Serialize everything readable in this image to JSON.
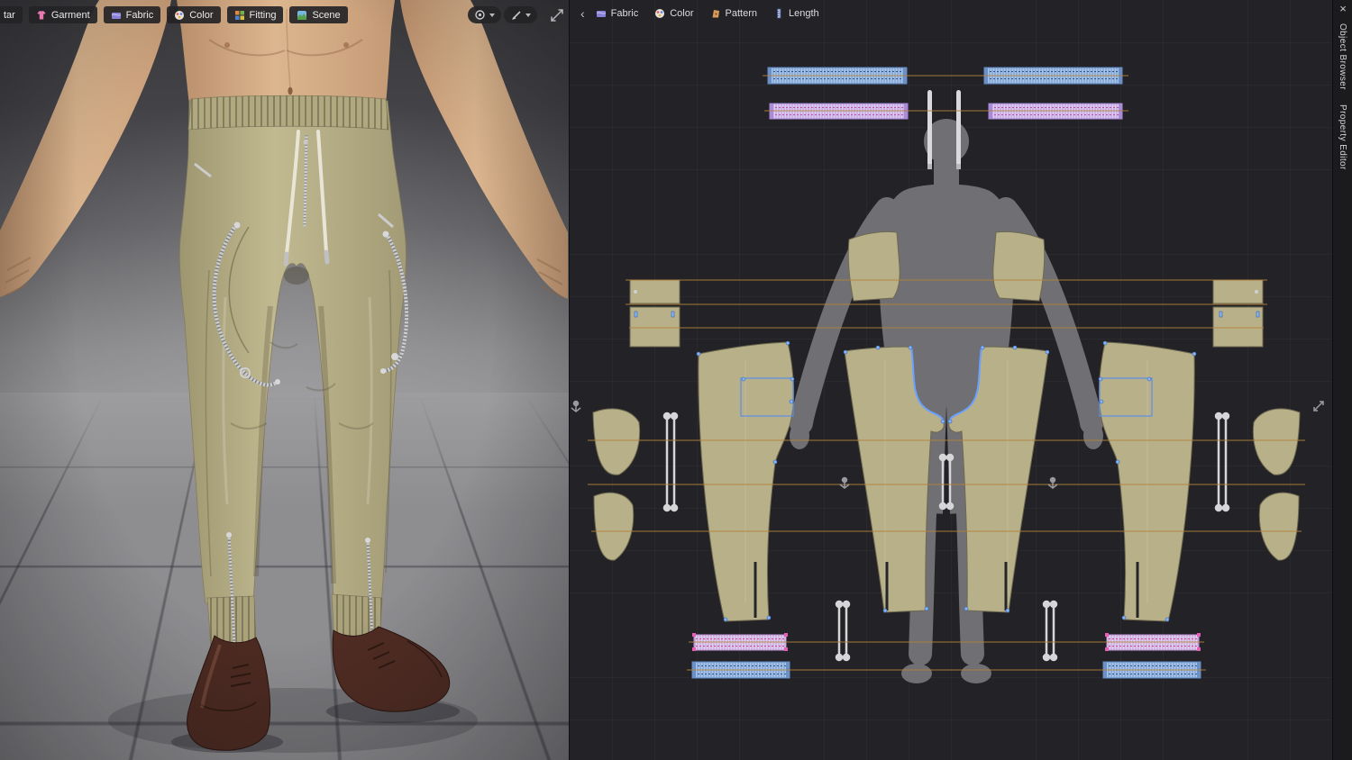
{
  "left_toolbar": {
    "buttons": [
      {
        "label": "tar"
      },
      {
        "label": "Garment"
      },
      {
        "label": "Fabric"
      },
      {
        "label": "Color"
      },
      {
        "label": "Fitting"
      },
      {
        "label": "Scene"
      }
    ]
  },
  "pattern_toolbar": {
    "back": "‹",
    "buttons": [
      {
        "label": "Fabric"
      },
      {
        "label": "Color"
      },
      {
        "label": "Pattern"
      },
      {
        "label": "Length"
      }
    ]
  },
  "right_rail": {
    "close": "×",
    "tabs": [
      "Object Browser",
      "Property Editor"
    ]
  },
  "colors": {
    "khaki_piece": "#b8b088",
    "seam_orange": "#b5823c",
    "band_blue": "#a9c6ea",
    "band_purple": "#ddcdf1",
    "selection_blue": "#5b8fe8",
    "pants_khaki": "#b4ab83",
    "shoe_brown": "#4c2a21"
  }
}
